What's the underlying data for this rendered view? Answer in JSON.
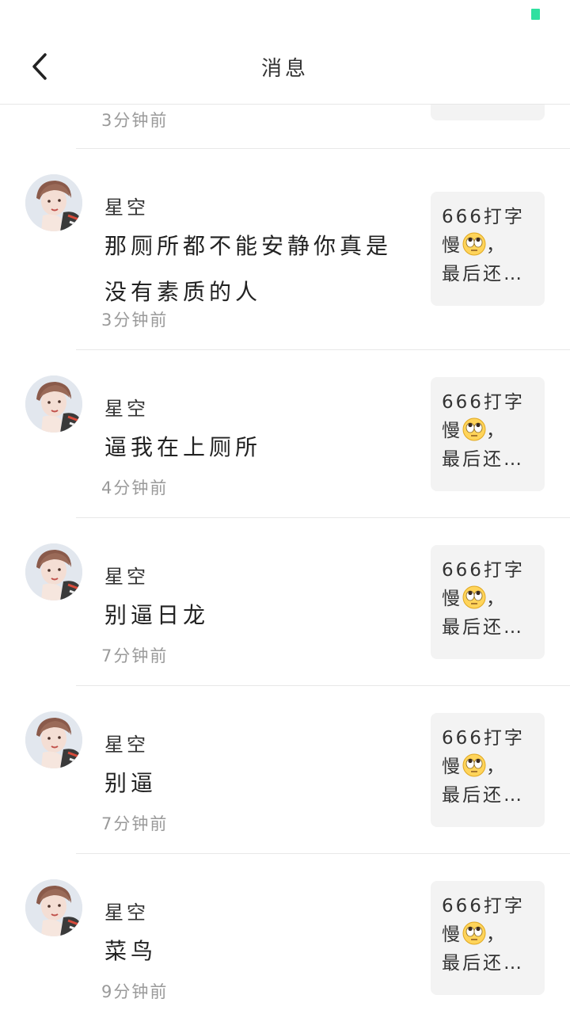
{
  "header": {
    "title": "消息"
  },
  "first_partial": {
    "time": "3分钟前"
  },
  "preview": {
    "line1": "666打字",
    "line2_text": "慢",
    "line2_suffix": "，",
    "line3": "最后还…"
  },
  "items": [
    {
      "username": "星空",
      "message": "那厕所都不能安静你真是没有素质的人",
      "time": "3分钟前"
    },
    {
      "username": "星空",
      "message": "逼我在上厕所",
      "time": "4分钟前"
    },
    {
      "username": "星空",
      "message": "别逼日龙",
      "time": "7分钟前"
    },
    {
      "username": "星空",
      "message": "别逼",
      "time": "7分钟前"
    },
    {
      "username": "星空",
      "message": "菜鸟",
      "time": "9分钟前"
    }
  ],
  "colors": {
    "accent": "#2fe0a0",
    "preview_bg": "#f3f3f3",
    "divider": "#e8e8e8",
    "muted": "#9a9a9a"
  }
}
